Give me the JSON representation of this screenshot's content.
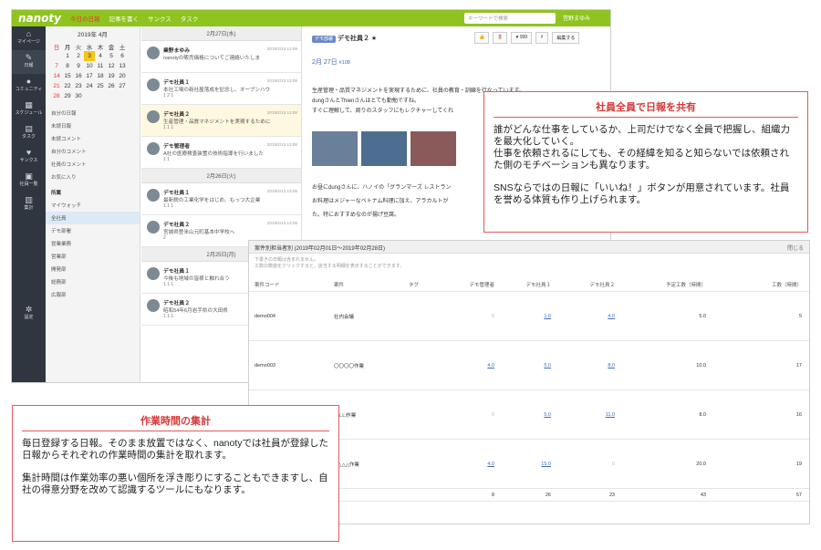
{
  "app": {
    "logo": "nanoty",
    "nav": [
      "今日の日報",
      "記事を書く",
      "サンクス",
      "タスク"
    ],
    "search_placeholder": "キーワードで検索",
    "user": "営野まゆみ"
  },
  "leftnav": [
    "マイページ",
    "日報",
    "コミュニティ",
    "スケジュール",
    "タスク",
    "サンクス",
    "社員一覧",
    "集計",
    "設定"
  ],
  "calendar": {
    "month": "2019年 4月",
    "weekdays": [
      "日",
      "月",
      "火",
      "水",
      "木",
      "金",
      "土"
    ],
    "weeks": [
      [
        "",
        "1",
        "2",
        "3",
        "4",
        "5",
        "6"
      ],
      [
        "7",
        "8",
        "9",
        "10",
        "11",
        "12",
        "13"
      ],
      [
        "14",
        "15",
        "16",
        "17",
        "18",
        "19",
        "20"
      ],
      [
        "21",
        "22",
        "23",
        "24",
        "25",
        "26",
        "27"
      ],
      [
        "28",
        "29",
        "30",
        "",
        "",
        "",
        ""
      ]
    ]
  },
  "menu": [
    "自分の日報",
    "未読日報",
    "未読コメント",
    "自分のコメント",
    "社員のコメント",
    "お気に入り"
  ],
  "groups_title": "所属",
  "groups": [
    "マイウォッチ",
    "全社員",
    "デモ部署",
    "営業業務",
    "営業部",
    "開発部",
    "総務部",
    "広報部"
  ],
  "list": {
    "d1": "2月27日(水)",
    "d2": "2月26日(火)",
    "d3": "2月25日(月)",
    "items": [
      {
        "name": "業野まゆみ",
        "date": "2019/2/13 13:09",
        "text": "nanotyの販売価格についてご連絡いたしま",
        "react": ""
      },
      {
        "name": "デモ社員１",
        "date": "2019/2/13 13:08",
        "text": "本社工場の新社屋落成を記念し、オープンハウ",
        "react": "1  2  1"
      },
      {
        "name": "デモ社員２",
        "date": "2019/2/13 13:08",
        "text": "生産管理・品質マネジメントを実現するために",
        "react": "1  1  1"
      },
      {
        "name": "デモ管理者",
        "date": "2019/2/13 13:08",
        "text": "A社の医療検査装置の技術指導を行いました",
        "react": "1  1"
      },
      {
        "name": "デモ社員１",
        "date": "2019/2/13 13:08",
        "text": "最新鋭の工業化学をはじめ、もっつ大企業",
        "react": "1  1  1"
      },
      {
        "name": "デモ社員２",
        "date": "2019/2/13 13:08",
        "text": "宮城県登米山元町基本中学校へ",
        "react": "2"
      },
      {
        "name": "デモ社員１",
        "date": "2019/2/13 13:08",
        "text": "今後も地域の皆様と触れ合う",
        "react": "1  1  1"
      },
      {
        "name": "デモ社員２",
        "date": "2019/2/13 13:08",
        "text": "昭和54年6月岩手県の大田県",
        "react": "1  1  1"
      }
    ]
  },
  "detail": {
    "tag": "デモ部署",
    "name": "デモ社員２",
    "date": "2月 27日",
    "num": "#108",
    "buttons": [
      "👍",
      "🌷",
      "♥ 999",
      "⇑",
      "編集する"
    ],
    "p1": "生産管理・品質マネジメントを実現するために、社員の教育・訓練を行なっています。",
    "p2": "dungさんとThienさんはとても勤勉ですね。",
    "p3": "すぐに理解して、周りのスタッフにもレクチャーしてくれ",
    "p4": "お昼にdungさんに、ハノイの「グランマーズ レストラン",
    "p5": "お料理はメジャーなベトナム料理に加え、アラカルトが",
    "p6": "た。特におすすめなのが揚げ豆腐。"
  },
  "callout1": {
    "title": "社員全員で日報を共有",
    "p1": "誰がどんな仕事をしているか、上司だけでなく全員で把握し、組織力を最大化していく。",
    "p2": "仕事を依頼されるにしても、その経緯を知ると知らないでは依頼された側のモチベーションも異なります。",
    "p3": "SNSならではの日報に「いいね！」ボタンが用意されています。社員を誉める体質も作り上げられます。"
  },
  "callout2": {
    "title": "作業時間の集計",
    "p1": "毎日登録する日報。そのまま放置ではなく、nanotyでは社員が登録した日報からそれぞれの作業時間の集計を取れます。",
    "p2": "集計時間は作業効率の悪い個所を浮き彫りにすることもできますし、自社の得意分野を改めて認識するツールにもなります。"
  },
  "report": {
    "title": "案件別担当者別 (2019年02月01日～2019年02月28日)",
    "close": "閉じる",
    "note1": "下書きの日報は含まれません。",
    "note2": "工数の数値をクリックすると、該当する明細を表示することができます。",
    "headers": [
      "案件コード",
      "案件",
      "タグ",
      "デモ管理者",
      "デモ社員１",
      "デモ社員２",
      "予定工数（時間）",
      "工数（時間）"
    ],
    "rows": [
      [
        "demo004",
        "社内会議",
        "",
        "0",
        "1.0",
        "4.0",
        "5.0",
        "5"
      ],
      [
        "demo003",
        "〇〇〇〇作業",
        "",
        "4.0",
        "5.0",
        "8.0",
        "10.0",
        "17"
      ],
      [
        "",
        "□□□□作業",
        "",
        "0",
        "5.0",
        "11.0",
        "8.0",
        "16"
      ],
      [
        "",
        "△△△△作業",
        "",
        "4.0",
        "15.0",
        "0",
        "20.0",
        "19"
      ]
    ],
    "totals": [
      "",
      "",
      "",
      "8",
      "26",
      "23",
      "43",
      "57"
    ]
  }
}
